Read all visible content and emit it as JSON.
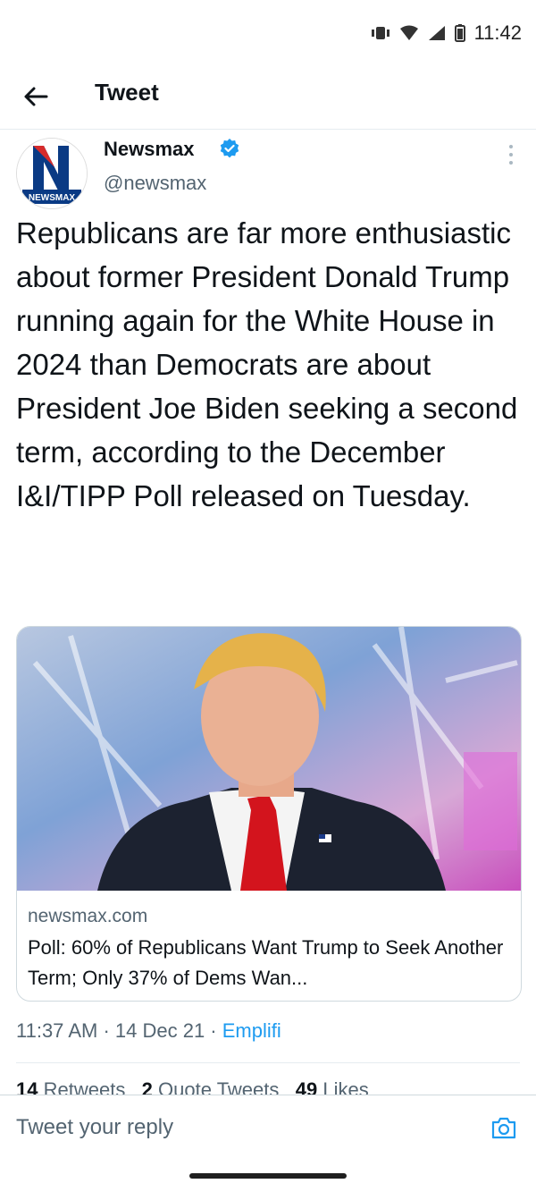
{
  "status": {
    "time": "11:42"
  },
  "header": {
    "title": "Tweet"
  },
  "author": {
    "name": "Newsmax",
    "handle": "@newsmax",
    "avatar_text": "NEWSMAX"
  },
  "tweet": {
    "text": "Republicans are far more enthusiastic about former President Donald Trump running again for the White House in 2024 than Democrats are about President Joe Biden seeking a second term, according to the December I&I/TIPP Poll released on Tuesday."
  },
  "card": {
    "domain": "newsmax.com",
    "title": "Poll: 60% of Republicans Want Trump to Seek Another Term; Only 37% of Dems Wan..."
  },
  "meta": {
    "time": "11:37 AM",
    "date": "14 Dec 21",
    "source": "Emplifi",
    "sep": " · "
  },
  "counts": {
    "retweets": "14",
    "retweets_label": "Retweets",
    "quotes": "2",
    "quotes_label": "Quote Tweets",
    "likes": "49",
    "likes_label": "Likes"
  },
  "reply": {
    "placeholder": "Tweet your reply"
  },
  "colors": {
    "accent": "#1d9bf0",
    "brand_red": "#d62b2b",
    "brand_blue": "#0a3a84"
  },
  "icons": [
    "vibrate-icon",
    "wifi-icon",
    "signal-icon",
    "battery-icon",
    "back-arrow-icon",
    "verified-icon",
    "more-icon",
    "camera-icon"
  ]
}
